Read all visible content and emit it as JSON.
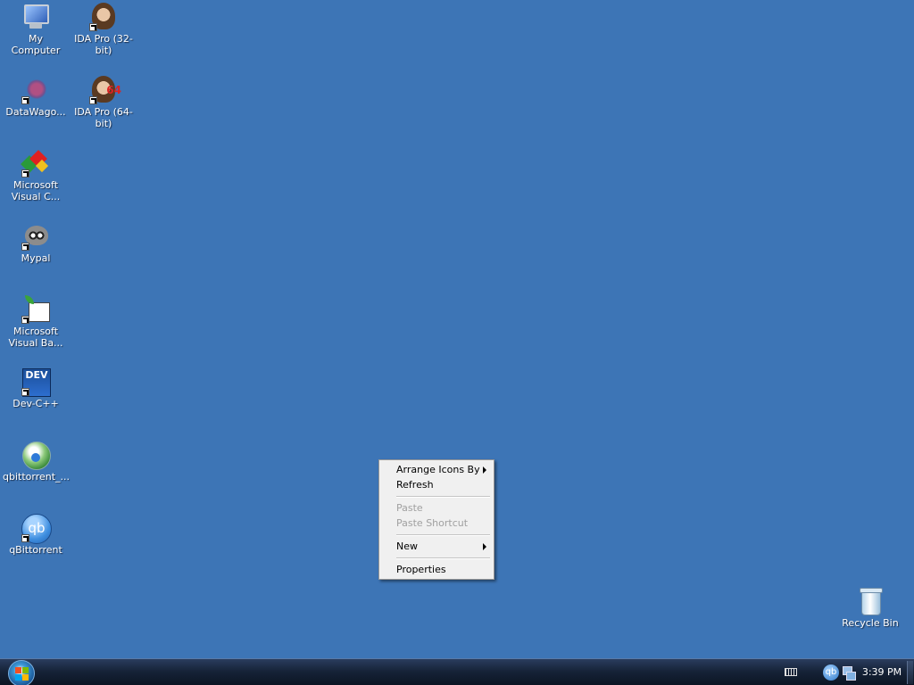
{
  "desktop": {
    "background_color": "#3d75b6",
    "icons": [
      {
        "label": "My Computer",
        "icon": "computer-icon"
      },
      {
        "label": "IDA Pro (32-bit)",
        "icon": "ida-pro-icon"
      },
      {
        "label": "DataWago...",
        "icon": "datawago-icon"
      },
      {
        "label": "IDA Pro (64-bit)",
        "icon": "ida-pro-64-icon",
        "badge": "64"
      },
      {
        "label": "Microsoft Visual C...",
        "icon": "visual-cpp-icon"
      },
      {
        "label": "Mypal",
        "icon": "mypal-icon"
      },
      {
        "label": "Microsoft Visual Ba...",
        "icon": "visual-basic-icon"
      },
      {
        "label": "Dev-C++",
        "icon": "dev-cpp-icon",
        "badge": "DEV"
      },
      {
        "label": "qbittorrent_...",
        "icon": "qbittorrent-installer-icon"
      },
      {
        "label": "qBittorrent",
        "icon": "qbittorrent-icon",
        "badge": "qb"
      },
      {
        "label": "Recycle Bin",
        "icon": "recycle-bin-icon"
      }
    ]
  },
  "context_menu": {
    "items": [
      {
        "label": "Arrange Icons By",
        "submenu": true,
        "enabled": true
      },
      {
        "label": "Refresh",
        "submenu": false,
        "enabled": true
      },
      {
        "label": "Paste",
        "submenu": false,
        "enabled": false
      },
      {
        "label": "Paste Shortcut",
        "submenu": false,
        "enabled": false
      },
      {
        "label": "New",
        "submenu": true,
        "enabled": true
      },
      {
        "label": "Properties",
        "submenu": false,
        "enabled": true
      }
    ]
  },
  "taskbar": {
    "tray": {
      "qb_label": "qb",
      "clock": "3:39 PM"
    }
  }
}
